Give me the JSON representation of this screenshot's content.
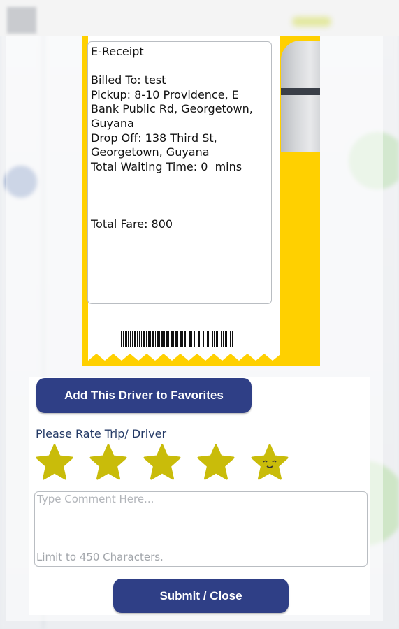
{
  "receipt": {
    "title": "E-Receipt",
    "billed_to": "Billed To: test",
    "pickup": "Pickup: 8-10 Providence, E Bank Public Rd, Georgetown, Guyana",
    "drop_off": "Drop Off: 138 Third St, Georgetown, Guyana",
    "waiting_time": "Total Waiting Time: 0  mins",
    "total_fare": "Total Fare: 800"
  },
  "favorites_button": "Add This Driver to Favorites",
  "rating": {
    "label": "Please Rate Trip/ Driver",
    "value": 5,
    "max": 5,
    "star_color": "#c9bc0a"
  },
  "comment": {
    "placeholder": "Type Comment Here...",
    "limit_hint": "Limit to 450 Characters."
  },
  "submit_button": "Submit / Close",
  "colors": {
    "button": "#2f3f86",
    "receipt_frame": "#ffd000",
    "label_text": "#243a66"
  }
}
